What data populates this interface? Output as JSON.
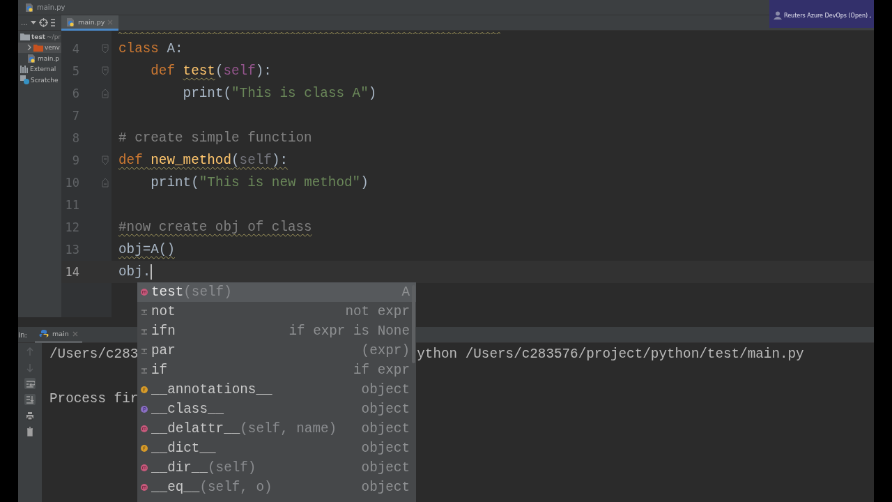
{
  "breadcrumb": {
    "file": "main.py"
  },
  "notification": {
    "text": "Reuters Azure DevOps (Open) ,"
  },
  "project_toolbar": {
    "menu": "..."
  },
  "editor_tabs": [
    {
      "label": "main.py",
      "selected": true
    }
  ],
  "project_tree": [
    {
      "kind": "folder",
      "label": "test",
      "hint": "~/pr",
      "selected": false,
      "expanded": true,
      "children": [
        {
          "kind": "folder",
          "label": "venv",
          "selected": true,
          "expanded": false
        },
        {
          "kind": "python",
          "label": "main.p",
          "selected": false
        }
      ]
    },
    {
      "kind": "libraries",
      "label": "External",
      "selected": false
    },
    {
      "kind": "scratches",
      "label": "Scratche",
      "selected": false
    }
  ],
  "code_lines": [
    {
      "number": "4",
      "kind": "fold-start",
      "current": false,
      "tokens": [
        {
          "text": "class",
          "kind": "keyword",
          "warn": false
        },
        {
          "text": " A:",
          "kind": "plain",
          "warn": false
        }
      ],
      "children": [
        {
          "number": "5",
          "kind": "fold-start",
          "current": false,
          "tokens": [
            {
              "text": "def ",
              "kind": "keyword",
              "warn": false
            },
            {
              "text": "test",
              "kind": "function",
              "warn": true
            },
            {
              "text": "(",
              "kind": "plain",
              "warn": false
            },
            {
              "text": "self",
              "kind": "self",
              "warn": false
            },
            {
              "text": "):",
              "kind": "plain",
              "warn": false
            }
          ],
          "children": [
            {
              "number": "6",
              "kind": "fold-end",
              "current": false,
              "tokens": [
                {
                  "text": "print(",
                  "kind": "plain",
                  "warn": false
                },
                {
                  "text": "\"This is class A\"",
                  "kind": "string",
                  "warn": false
                },
                {
                  "text": ")",
                  "kind": "plain",
                  "warn": false
                }
              ]
            }
          ]
        }
      ]
    },
    {
      "number": "7",
      "kind": "plain",
      "current": false
    },
    {
      "number": "8",
      "kind": "plain",
      "current": false,
      "tokens": [
        {
          "text": "# create simple function",
          "kind": "comment",
          "warn": false
        }
      ]
    },
    {
      "number": "9",
      "kind": "fold-start",
      "current": false,
      "tokens": [
        {
          "text": "def ",
          "kind": "keyword",
          "warn": true
        },
        {
          "text": "new_method",
          "kind": "function",
          "warn": true
        },
        {
          "text": "(",
          "kind": "plain",
          "warn": true
        },
        {
          "text": "self",
          "kind": "unused",
          "warn": true
        },
        {
          "text": "):",
          "kind": "plain",
          "warn": true
        }
      ],
      "children": [
        {
          "number": "10",
          "kind": "fold-end",
          "current": false,
          "tokens": [
            {
              "text": "print(",
              "kind": "plain",
              "warn": false
            },
            {
              "text": "\"This is new method\"",
              "kind": "string",
              "warn": false
            },
            {
              "text": ")",
              "kind": "plain",
              "warn": false
            }
          ]
        }
      ]
    },
    {
      "number": "11",
      "kind": "plain",
      "current": false
    },
    {
      "number": "12",
      "kind": "plain",
      "current": false,
      "tokens": [
        {
          "text": "#now create obj of class",
          "kind": "comment",
          "warn": true
        }
      ]
    },
    {
      "number": "13",
      "kind": "plain",
      "current": false,
      "tokens": [
        {
          "text": "obj=A()",
          "kind": "plain",
          "warn": true
        }
      ]
    },
    {
      "number": "14",
      "kind": "plain",
      "current": true,
      "tokens": [
        {
          "text": "obj.",
          "kind": "plain",
          "warn": false
        }
      ]
    }
  ],
  "completion_popup": {
    "items": [
      {
        "kind": "method",
        "name": "test",
        "params": "(self)",
        "type": "A",
        "selected": true
      },
      {
        "kind": "postfix",
        "name": "not",
        "type": "not expr",
        "selected": false
      },
      {
        "kind": "postfix",
        "name": "ifn",
        "type": "if expr is None",
        "selected": false
      },
      {
        "kind": "postfix",
        "name": "par",
        "type": "(expr)",
        "selected": false
      },
      {
        "kind": "postfix",
        "name": "if",
        "type": "if expr",
        "selected": false
      },
      {
        "kind": "field",
        "name": "__annotations__",
        "type": "object",
        "selected": false
      },
      {
        "kind": "property",
        "name": "__class__",
        "type": "object",
        "selected": false
      },
      {
        "kind": "method",
        "name": "__delattr__",
        "params": "(self, name)",
        "type": "object",
        "selected": false
      },
      {
        "kind": "field",
        "name": "__dict__",
        "type": "object",
        "selected": false
      },
      {
        "kind": "method",
        "name": "__dir__",
        "params": "(self)",
        "type": "object",
        "selected": false
      },
      {
        "kind": "method",
        "name": "__eq__",
        "params": "(self, o)",
        "type": "object",
        "selected": false
      }
    ]
  },
  "run_panel": {
    "label": "in:",
    "tabs": [
      {
        "label": "main",
        "selected": true
      }
    ],
    "output_lines": [
      {
        "before": "/Users/c283",
        "after": "ython /Users/c283576/project/python/test/main.py"
      },
      {
        "before": "Process fir"
      }
    ]
  }
}
